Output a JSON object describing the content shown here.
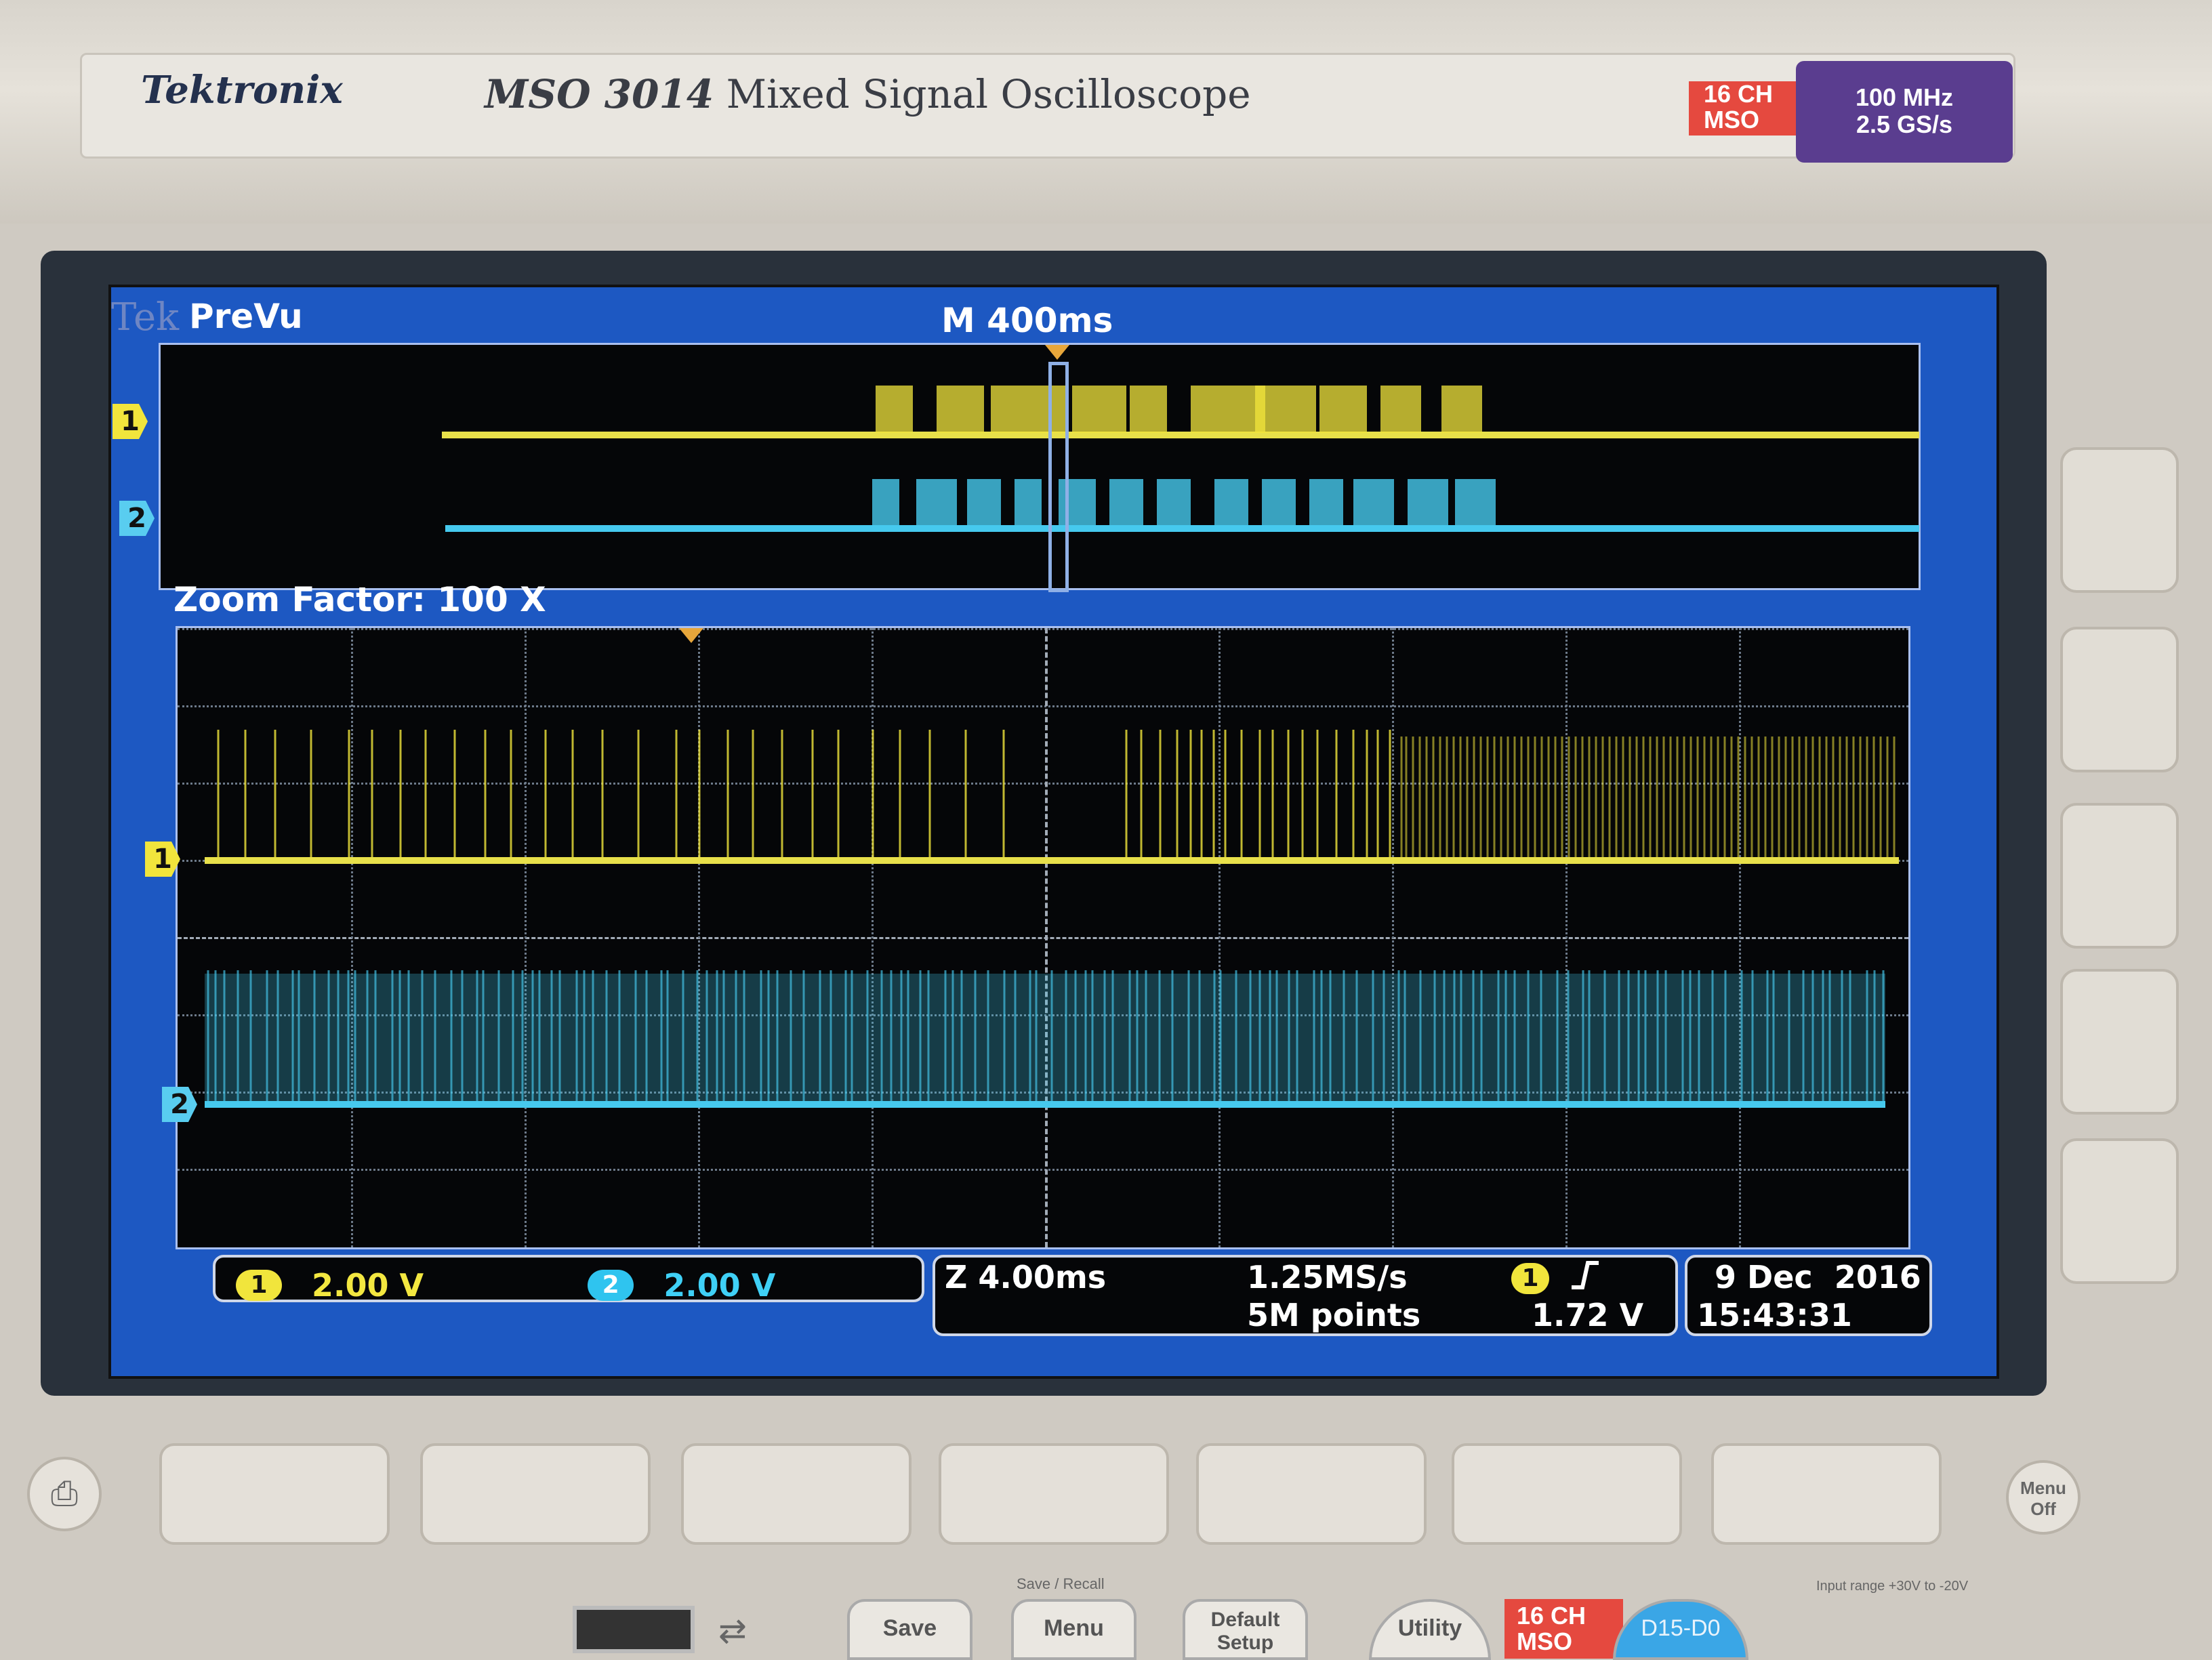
{
  "header": {
    "brand": "Tektronix",
    "model": "MSO 3014",
    "model_desc": "Mixed Signal Oscilloscope",
    "badge_channels": [
      "16 CH",
      "MSO"
    ],
    "badge_specs": [
      "100 MHz",
      "2.5 GS/s"
    ]
  },
  "screen": {
    "tek_logo": "Tek",
    "mode": "PreVu",
    "main_timebase": "M 400ms",
    "zoom_label": "Zoom Factor: 100 X",
    "channel_markers": {
      "ch1": "1",
      "ch2": "2"
    },
    "readouts": {
      "ch1_badge": "1",
      "ch1_scale": "2.00 V",
      "ch2_badge": "2",
      "ch2_scale": "2.00 V",
      "zoom_timebase": "Z 4.00ms",
      "sample_rate": "1.25MS/s",
      "record_length": "5M points",
      "trigger_source": "1",
      "trigger_slope_icon": "rising-edge-icon",
      "trigger_level": "1.72 V",
      "date": "9 Dec  2016",
      "time": "15:43:31"
    },
    "colors": {
      "ch1": "#f1e53c",
      "ch2": "#46c9ee",
      "screen_bg": "#1d58c2"
    }
  },
  "buttons": {
    "save_recall_label": "Save / Recall",
    "save": "Save",
    "menu": "Menu",
    "default_setup": "Default Setup",
    "utility": "Utility",
    "mso_badge": [
      "16 CH",
      "MSO"
    ],
    "d15_d0": "D15-D0",
    "menu_off": "Menu Off",
    "input_range": "Input range +30V to -20V"
  }
}
